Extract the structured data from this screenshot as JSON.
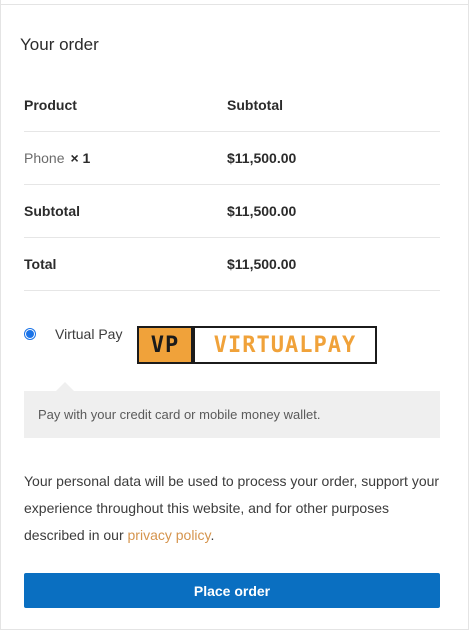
{
  "order": {
    "heading": "Your order",
    "columns": {
      "product": "Product",
      "subtotal": "Subtotal"
    },
    "items": [
      {
        "name": "Phone",
        "quantity": "× 1",
        "subtotal": "$11,500.00"
      }
    ],
    "subtotal": {
      "label": "Subtotal",
      "value": "$11,500.00"
    },
    "total": {
      "label": "Total",
      "value": "$11,500.00"
    }
  },
  "payment": {
    "method_label": "Virtual Pay",
    "selected": true,
    "logo": {
      "mark": "VP",
      "name": "VIRTUALPAY",
      "accent_color": "#f0a23a"
    },
    "description": "Pay with your credit card or mobile money wallet."
  },
  "privacy": {
    "text_before": "Your personal data will be used to process your order, support your experience throughout this website, and for other purposes described in our ",
    "link_text": "privacy policy",
    "text_after": "."
  },
  "actions": {
    "place_order_label": "Place order",
    "button_color": "#0a6fc1"
  }
}
